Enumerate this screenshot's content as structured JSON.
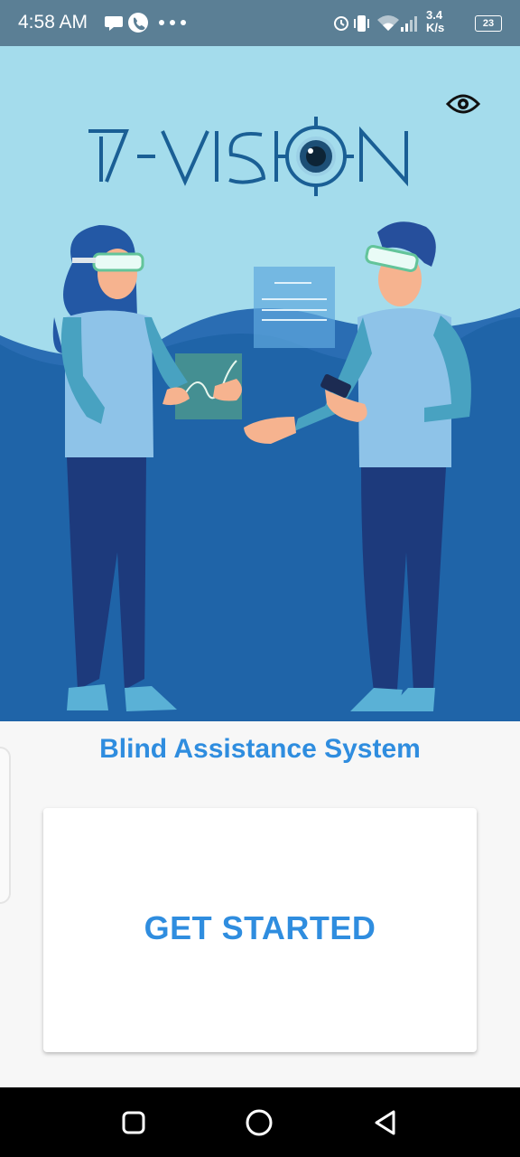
{
  "status_bar": {
    "time": "4:58 AM",
    "net_speed_value": "3.4",
    "net_speed_unit": "K/s",
    "battery": "23",
    "icons": [
      "chat-bubble-icon",
      "phone-icon",
      "more-dots-icon",
      "alarm-icon",
      "vibrate-icon",
      "wifi-icon",
      "signal-icon",
      "battery-icon"
    ]
  },
  "hero": {
    "logo_text": "I-VISION",
    "eye_toggle_icon": "eye-icon"
  },
  "main": {
    "subtitle": "Blind Assistance System",
    "cta_label": "GET STARTED"
  },
  "nav": {
    "icons": [
      "recents-square-icon",
      "home-circle-icon",
      "back-triangle-icon"
    ]
  },
  "colors": {
    "status_bg": "#5b7f95",
    "hero_bg": "#a4dcec",
    "wave_blue": "#1f64a8",
    "accent_blue": "#2f8ddf"
  }
}
